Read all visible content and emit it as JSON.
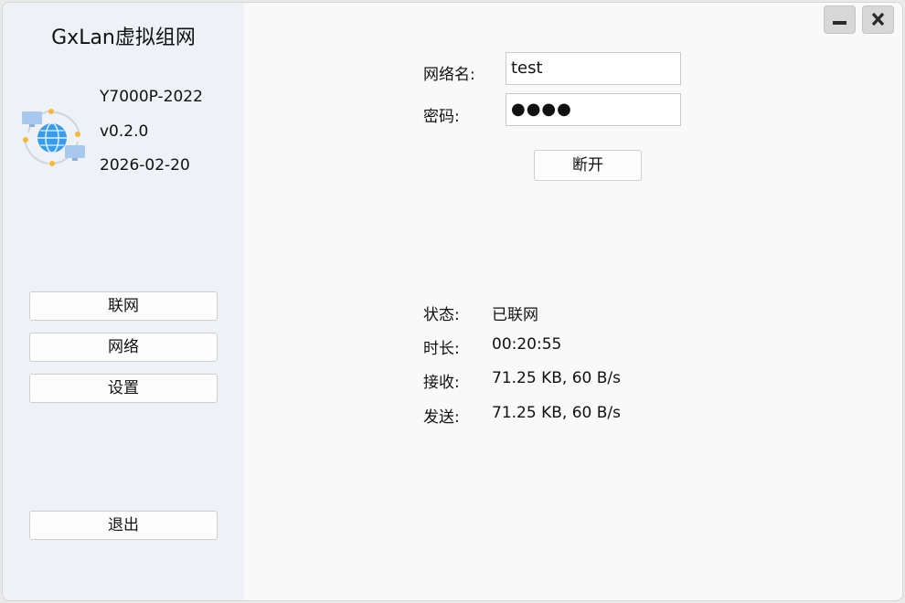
{
  "app": {
    "title": "GxLan虚拟组网",
    "device_name": "Y7000P-2022",
    "version": "v0.2.0",
    "date": "2026-02-20",
    "logo_icon": "network-globe-icon"
  },
  "window_controls": {
    "minimize_icon": "minimize-icon",
    "close_icon": "close-icon"
  },
  "sidebar": {
    "items": [
      {
        "label": "联网"
      },
      {
        "label": "网络"
      },
      {
        "label": "设置"
      }
    ],
    "exit_label": "退出"
  },
  "form": {
    "network_name_label": "网络名:",
    "network_name_value": "test",
    "password_label": "密码:",
    "password_value": "●●●●",
    "action_label": "断开"
  },
  "status": {
    "state_label": "状态:",
    "state_value": "已联网",
    "duration_label": "时长:",
    "duration_value": "00:20:55",
    "receive_label": "接收:",
    "receive_value": "71.25 KB, 60 B/s",
    "send_label": "发送:",
    "send_value": "71.25 KB, 60 B/s"
  },
  "colors": {
    "sidebar_bg": "#eef1f5",
    "main_bg": "#f9f9f9",
    "globe_blue": "#3b9be8",
    "logo_dot_yellow": "#f5b83d"
  }
}
